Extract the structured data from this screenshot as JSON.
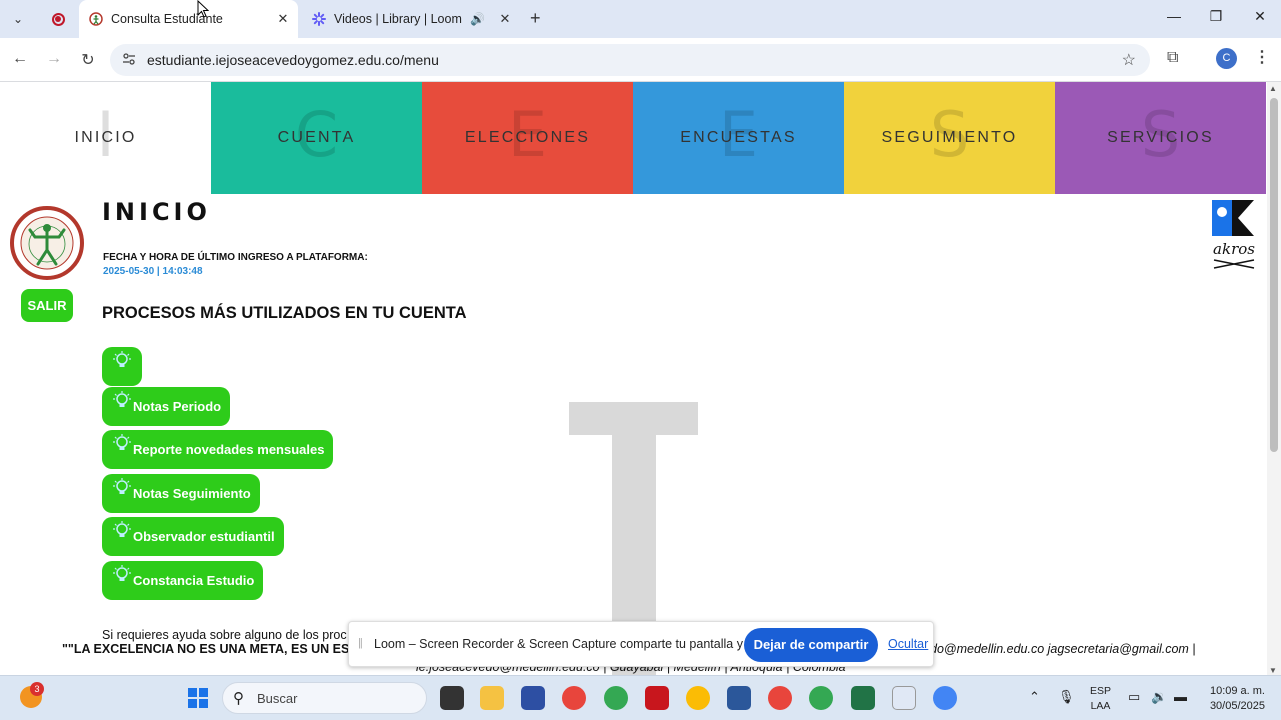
{
  "browser": {
    "tabs": [
      {
        "title": "Consulta Estudiante",
        "active": true
      },
      {
        "title": "Videos | Library | Loom",
        "active": false
      }
    ],
    "url": "estudiante.iejoseacevedoygomez.edu.co/menu",
    "profile_initial": "C"
  },
  "topnav": [
    {
      "label": "INICIO",
      "ghost": "I"
    },
    {
      "label": "CUENTA",
      "ghost": "C"
    },
    {
      "label": "ELECCIONES",
      "ghost": "E"
    },
    {
      "label": "ENCUESTAS",
      "ghost": "E"
    },
    {
      "label": "SEGUIMIENTO",
      "ghost": "S"
    },
    {
      "label": "SERVICIOS",
      "ghost": "S"
    }
  ],
  "sidebar": {
    "logout_label": "SALIR"
  },
  "main": {
    "title": "INICIO",
    "last_login_label": "FECHA Y HORA DE ÚLTIMO INGRESO A PLATAFORMA:",
    "last_login_value": "2025-05-30 | 14:03:48",
    "section_title": "PROCESOS MÁS UTILIZADOS EN TU CUENTA",
    "processes": [
      {
        "label": ""
      },
      {
        "label": "Notas Periodo"
      },
      {
        "label": "Reporte novedades mensuales"
      },
      {
        "label": "Notas Seguimiento"
      },
      {
        "label": "Observador estudiantil"
      },
      {
        "label": "Constancia Estudio"
      }
    ],
    "watermark_letter": "I",
    "help_text": "Si requieres ayuda sobre alguno de los proc"
  },
  "footer": {
    "quote": "\"\"LA EXCELENCIA NO ES UNA META, ES UN ES",
    "emails": "do@medellin.edu.co jagsecretaria@gmail.com  |",
    "address": "ie.joseacevedo@medellin.edu.co  |  Guayabal  |  Medellín  |  Antioquia  |  Colombia"
  },
  "brand": {
    "akros_text": "akros"
  },
  "loom_bar": {
    "message": "Loom – Screen Recorder & Screen Capture comparte tu pantalla y audio.",
    "stop_label": "Dejar de compartir",
    "hide_label": "Ocultar"
  },
  "taskbar": {
    "weather_badge": "3",
    "search_placeholder": "Buscar",
    "language": "ESP",
    "layout": "LAA",
    "time": "10:09 a. m.",
    "date": "30/05/2025"
  },
  "colors": {
    "cuenta": "#1abc9c",
    "elecciones": "#e74c3c",
    "encuestas": "#3498db",
    "seguimiento": "#f1d23c",
    "servicios": "#9b59b6",
    "button_green": "#2ecc1a",
    "loom_blue": "#1a5fd6"
  }
}
